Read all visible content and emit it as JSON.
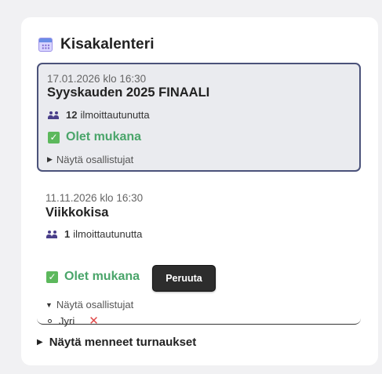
{
  "header": {
    "icon": "calendar-icon",
    "title": "Kisakalenteri"
  },
  "tournaments": [
    {
      "date": "17.01.2026 klo 16:30",
      "name": "Syyskauden 2025 FINAALI",
      "registered_count": "12",
      "registered_label": "ilmoittautunutta",
      "status": "Olet mukana",
      "toggle_label": "Näytä osallistujat",
      "toggle_state": "collapsed",
      "highlighted": true
    },
    {
      "date": "11.11.2026 klo 16:30",
      "name": "Viikkokisa",
      "registered_count": "1",
      "registered_label": "ilmoittautunutta",
      "status": "Olet mukana",
      "cancel_label": "Peruuta",
      "toggle_label": "Näytä osallistujat",
      "toggle_state": "expanded",
      "participants": [
        "Jyri"
      ]
    }
  ],
  "past_toggle_label": "Näytä menneet turnaukset",
  "colors": {
    "accent_border": "#4b527a",
    "status_green": "#4aa56a",
    "remove_red": "#e04848",
    "button_dark": "#2d2d2d"
  }
}
